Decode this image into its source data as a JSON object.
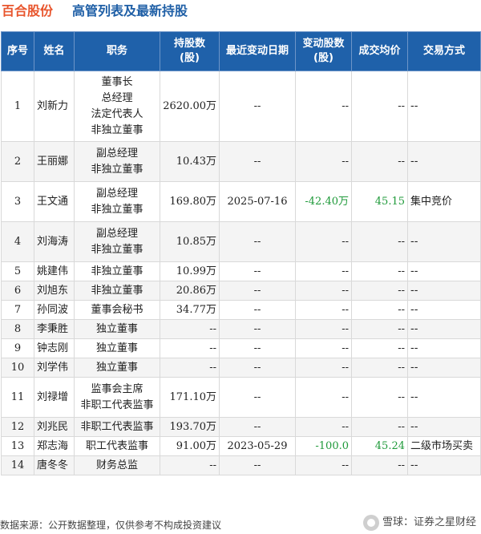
{
  "header": {
    "company": "百合股份",
    "title": "高管列表及最新持股"
  },
  "table": {
    "columns": [
      "序号",
      "姓名",
      "职务",
      "持股数\n(股)",
      "最近变动日期",
      "变动股数\n(股)",
      "成交均价",
      "交易方式"
    ],
    "rows": [
      {
        "seq": "1",
        "name": "刘新力",
        "positions": [
          "董事长",
          "总经理",
          "法定代表人",
          "非独立董事"
        ],
        "shares": "2620.00万",
        "date": "--",
        "change": "--",
        "price": "--",
        "method": "--"
      },
      {
        "seq": "2",
        "name": "王丽娜",
        "positions": [
          "副总经理",
          "非独立董事"
        ],
        "shares": "10.43万",
        "date": "--",
        "change": "--",
        "price": "--",
        "method": "--"
      },
      {
        "seq": "3",
        "name": "王文通",
        "positions": [
          "副总经理",
          "非独立董事"
        ],
        "shares": "169.80万",
        "date": "2025-07-16",
        "change": "-42.40万",
        "price": "45.15",
        "method": "集中竞价"
      },
      {
        "seq": "4",
        "name": "刘海涛",
        "positions": [
          "副总经理",
          "非独立董事"
        ],
        "shares": "10.85万",
        "date": "--",
        "change": "--",
        "price": "--",
        "method": "--"
      },
      {
        "seq": "5",
        "name": "姚建伟",
        "positions": [
          "非独立董事"
        ],
        "shares": "10.99万",
        "date": "--",
        "change": "--",
        "price": "--",
        "method": "--"
      },
      {
        "seq": "6",
        "name": "刘旭东",
        "positions": [
          "非独立董事"
        ],
        "shares": "20.86万",
        "date": "--",
        "change": "--",
        "price": "--",
        "method": "--"
      },
      {
        "seq": "7",
        "name": "孙同波",
        "positions": [
          "董事会秘书"
        ],
        "shares": "34.77万",
        "date": "--",
        "change": "--",
        "price": "--",
        "method": "--"
      },
      {
        "seq": "8",
        "name": "李秉胜",
        "positions": [
          "独立董事"
        ],
        "shares": "--",
        "date": "--",
        "change": "--",
        "price": "--",
        "method": "--"
      },
      {
        "seq": "9",
        "name": "钟志刚",
        "positions": [
          "独立董事"
        ],
        "shares": "--",
        "date": "--",
        "change": "--",
        "price": "--",
        "method": "--"
      },
      {
        "seq": "10",
        "name": "刘学伟",
        "positions": [
          "独立董事"
        ],
        "shares": "--",
        "date": "--",
        "change": "--",
        "price": "--",
        "method": "--"
      },
      {
        "seq": "11",
        "name": "刘禄增",
        "positions": [
          "监事会主席",
          "非职工代表监事"
        ],
        "shares": "171.10万",
        "date": "--",
        "change": "--",
        "price": "--",
        "method": "--"
      },
      {
        "seq": "12",
        "name": "刘兆民",
        "positions": [
          "非职工代表监事"
        ],
        "shares": "193.70万",
        "date": "--",
        "change": "--",
        "price": "--",
        "method": "--"
      },
      {
        "seq": "13",
        "name": "郑志海",
        "positions": [
          "职工代表监事"
        ],
        "shares": "91.00万",
        "date": "2023-05-29",
        "change": "-100.0",
        "price": "45.24",
        "method": "二级市场买卖"
      },
      {
        "seq": "14",
        "name": "唐冬冬",
        "positions": [
          "财务总监"
        ],
        "shares": "--",
        "date": "--",
        "change": "--",
        "price": "--",
        "method": "--"
      }
    ]
  },
  "footer": {
    "source": "数据来源：公开数据整理，仅供参考不构成投资建议",
    "brand": "雪球：证券之星财经"
  },
  "colors": {
    "company": "#e8552d",
    "title": "#1f5fa6",
    "header_bg": "#1f61aa",
    "change": "#1f9a3a"
  }
}
